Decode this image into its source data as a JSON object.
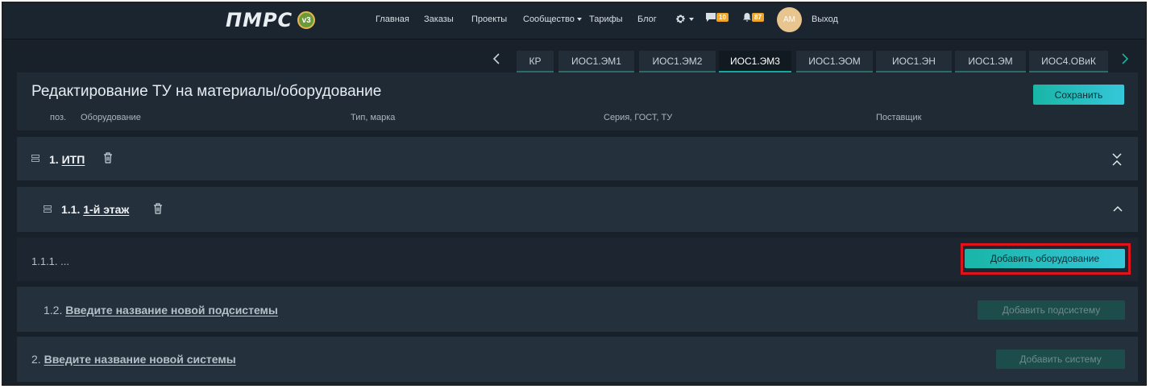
{
  "nav": {
    "logo_text": "ПМРС",
    "logo_badge": "v3",
    "items": [
      "Главная",
      "Заказы",
      "Проекты",
      "Сообщество",
      "Тарифы",
      "Блог"
    ],
    "messages_count": "10",
    "notifications_count": "87",
    "avatar_initials": "AM",
    "logout": "Выход"
  },
  "tabs": {
    "items": [
      "КР",
      "ИОС1.ЭМ1",
      "ИОС1.ЭМ2",
      "ИОС1.ЭМ3",
      "ИОС1.ЭОМ",
      "ИОС1.ЭН",
      "ИОС1.ЭМ",
      "ИОС4.ОВиК"
    ],
    "active": "ИОС1.ЭМ3"
  },
  "editor": {
    "title": "Редактирование ТУ на материалы/оборудование",
    "save_label": "Сохранить",
    "columns": [
      "поз.",
      "Оборудование",
      "Тип, марка",
      "Серия, ГОСТ, ТУ",
      "Поставщик"
    ]
  },
  "tree": {
    "system": {
      "number": "1.",
      "name": "ИТП"
    },
    "subsystem": {
      "number": "1.1.",
      "name": "1-й этаж"
    },
    "equipment_row": {
      "number": "1.1.1.",
      "placeholder": "...",
      "add_label": "Добавить оборудование"
    },
    "new_subsystem": {
      "number": "1.2.",
      "name": "Введите название новой подсистемы",
      "add_label": "Добавить подсистему"
    },
    "new_system": {
      "number": "2.",
      "name": "Введите название новой системы",
      "add_label": "Добавить систему"
    }
  },
  "colors": {
    "accent": "#19b5a6",
    "highlight": "#e0131b",
    "badge": "#f2a626"
  }
}
